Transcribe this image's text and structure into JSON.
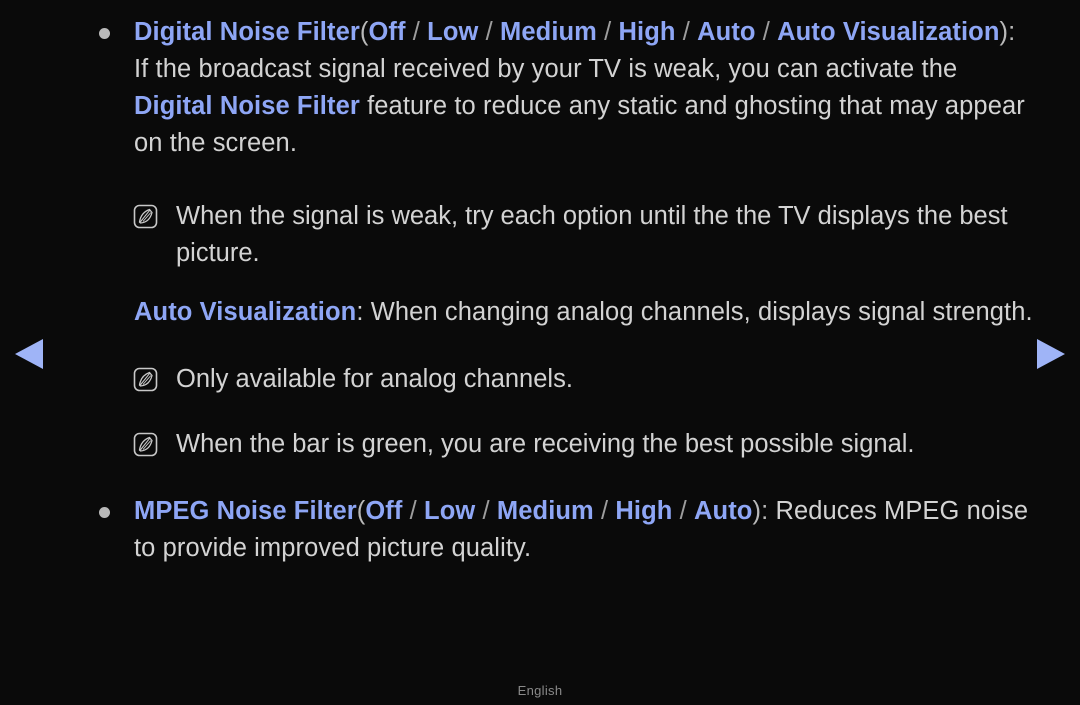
{
  "page": {
    "background_color": "#0a0a0a",
    "accent_color": "#8ea6f5",
    "body_text_color": "#d3d3d3"
  },
  "navigation": {
    "prev_label": "Previous page",
    "next_label": "Next page",
    "prev_icon": "triangle-left-icon",
    "next_icon": "triangle-right-icon",
    "arrow_color": "#9fb4f7"
  },
  "footer": {
    "language": "English"
  },
  "sections": [
    {
      "id": "digital-noise-filter",
      "title": "Digital Noise Filter",
      "options": [
        "Off",
        "Low",
        "Medium",
        "High",
        "Auto",
        "Auto Visualization"
      ],
      "option_separator": "/",
      "open_paren": "(",
      "close_paren": ")",
      "colon": ":",
      "body_part_1": "If the broadcast signal received by your TV is weak, you can activate the ",
      "body_emphasis_1": "Digital",
      "body_emphasis_2": "Noise Filter",
      "body_part_2": " feature to reduce any static and ghosting that may appear on the",
      "body_part_3": "screen.",
      "notes": [
        {
          "icon": "note-icon",
          "text": "When the signal is weak, try each option until the the TV displays the best",
          "continuation": "picture."
        }
      ],
      "subsection": {
        "term": "Auto Visualization",
        "colon": ":",
        "description": " When changing analog channels, displays signal strength.",
        "notes": [
          {
            "icon": "note-icon",
            "text": "Only available for analog channels."
          },
          {
            "icon": "note-icon",
            "text": "When the bar is green, you are receiving the best possible signal."
          }
        ]
      }
    },
    {
      "id": "mpeg-noise-filter",
      "title": "MPEG Noise Filter",
      "options": [
        "Off",
        "Low",
        "Medium",
        "High",
        "Auto"
      ],
      "option_separator": "/",
      "open_paren": "(",
      "close_paren": ")",
      "colon": ":",
      "body_part_1": " Reduces MPEG noise",
      "body_part_2": "to provide improved picture quality."
    }
  ]
}
